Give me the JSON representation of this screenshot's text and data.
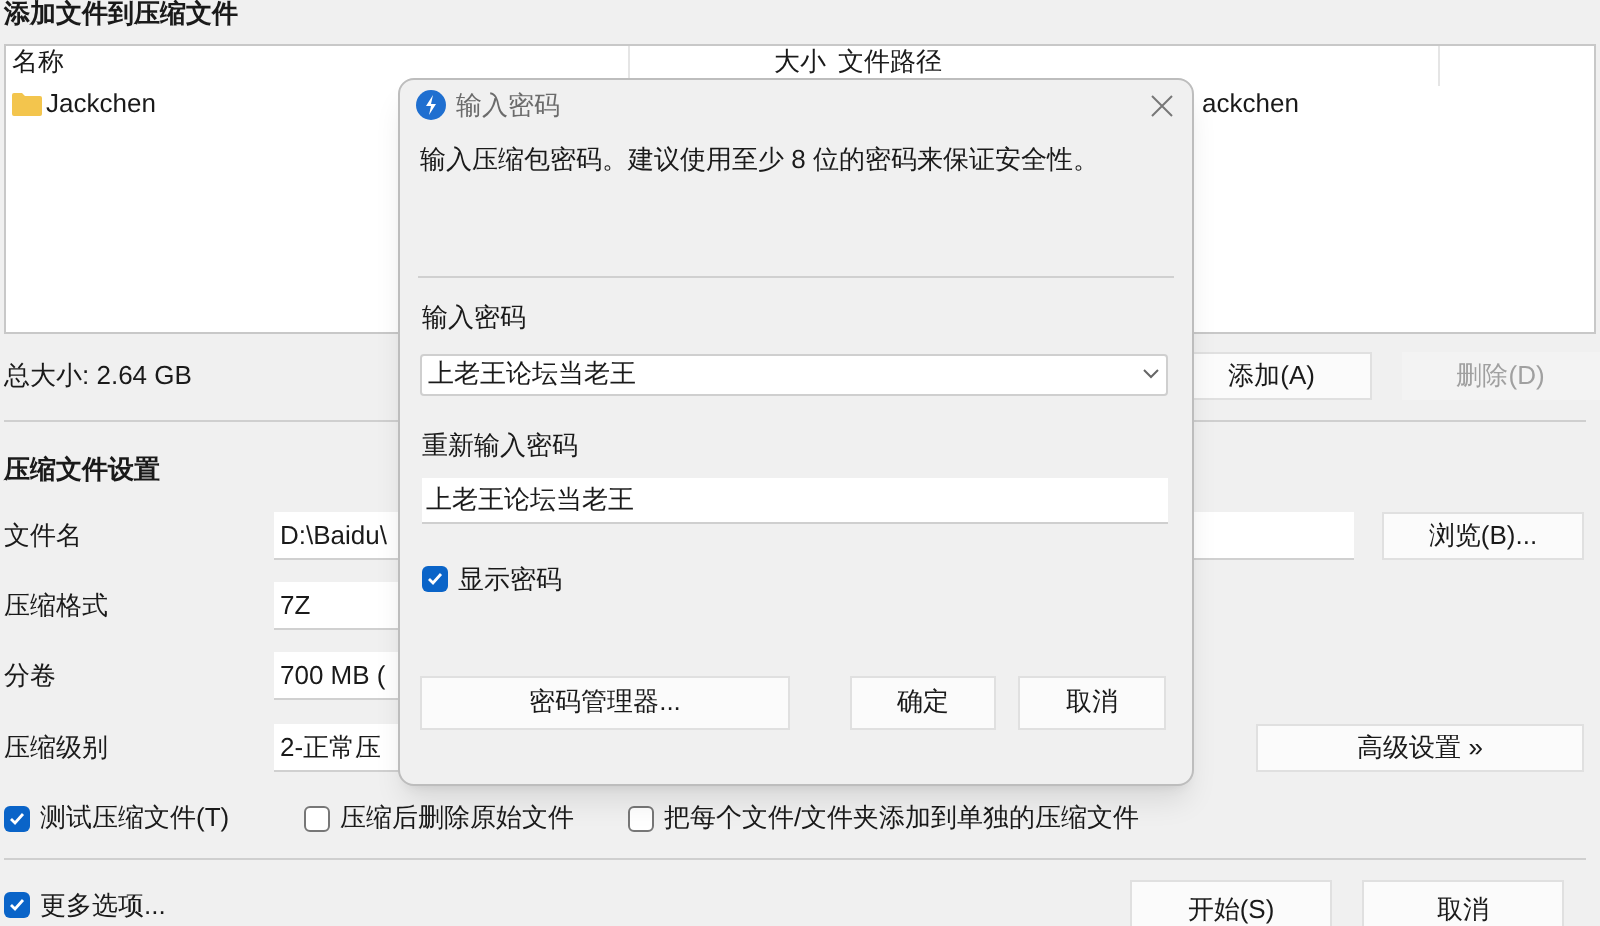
{
  "window": {
    "title": "添加文件到压缩文件"
  },
  "file_list": {
    "columns": [
      {
        "label": "名称"
      },
      {
        "label": "大小"
      },
      {
        "label": "文件路径"
      }
    ],
    "rows": [
      {
        "name": "Jackchen",
        "path": "ackchen"
      }
    ]
  },
  "total_size": "总大小: 2.64 GB",
  "list_buttons": [
    {
      "label": "添加(A)",
      "disabled": false
    },
    {
      "label": "删除(D)",
      "disabled": true
    }
  ],
  "settings": {
    "title": "压缩文件设置",
    "rows": [
      {
        "label": "文件名",
        "value": "D:\\Baidu\\"
      },
      {
        "label": "压缩格式",
        "value": "7Z"
      },
      {
        "label": "分卷",
        "value": "700 MB ("
      },
      {
        "label": "压缩级别",
        "value": "2-正常压"
      }
    ],
    "browse_button": "浏览(B)...",
    "advanced_button": "高级设置 »"
  },
  "options": [
    {
      "label": "测试压缩文件(T)",
      "checked": true
    },
    {
      "label": "压缩后删除原始文件",
      "checked": false
    },
    {
      "label": "把每个文件/文件夹添加到单独的压缩文件",
      "checked": false
    }
  ],
  "more_options": {
    "label": "更多选项...",
    "checked": true
  },
  "bottom_buttons": [
    "开始(S)",
    "取消"
  ],
  "dialog": {
    "title": "输入密码",
    "message": "输入压缩包密码。建议使用至少 8 位的密码来保证安全性。",
    "password_label": "输入密码",
    "password": "上老王论坛当老王",
    "confirm_label": "重新输入密码",
    "confirm": "上老王论坛当老王",
    "show_password": {
      "label": "显示密码",
      "checked": true
    },
    "buttons": [
      "密码管理器...",
      "确定",
      "取消"
    ]
  }
}
